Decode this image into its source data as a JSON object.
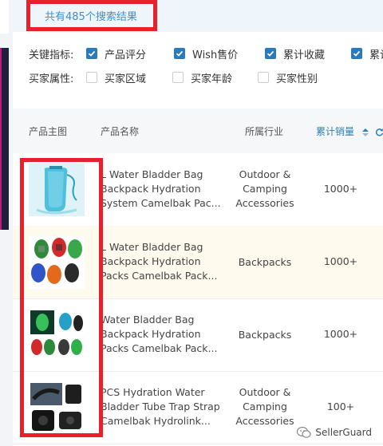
{
  "result_text": "共有485个搜索结果",
  "filters": {
    "key_label": "关键指标:",
    "key_options": [
      {
        "label": "产品评分",
        "checked": true
      },
      {
        "label": "Wish售价",
        "checked": true
      },
      {
        "label": "累计收藏",
        "checked": true
      },
      {
        "label": "累计",
        "checked": true
      }
    ],
    "buyer_label": "买家属性:",
    "buyer_options": [
      {
        "label": "买家区域",
        "checked": false
      },
      {
        "label": "买家年龄",
        "checked": false
      },
      {
        "label": "买家性别",
        "checked": false
      }
    ]
  },
  "table": {
    "headers": {
      "image": "产品主图",
      "name": "产品名称",
      "industry": "所属行业",
      "sales": "累计销量"
    },
    "rows": [
      {
        "name": "L Water Bladder Bag Backpack Hydration System Camelbak Pac...",
        "industry": "Outdoor & Camping Accessories",
        "sales": "1000+",
        "thumb": "blue-water-bladder"
      },
      {
        "name": "L Water Bladder Bag Backpack Hydration Packs Camelbak Pack...",
        "industry": "Backpacks",
        "sales": "1000+",
        "thumb": "colorful-hydration-backpacks"
      },
      {
        "name": "Water Bladder Bag Backpack Hydration Packs Camelbak Pack...",
        "industry": "Backpacks",
        "sales": "1000+",
        "thumb": "green-hydration-backpacks"
      },
      {
        "name": "PCS Hydration Water Bladder Tube Trap Strap Camelbak Hydrolink...",
        "industry": "Outdoor & Camping Accessories",
        "sales": "100+",
        "thumb": "black-tube-clips"
      }
    ]
  },
  "watermark": "SellerGuard",
  "colors": {
    "accent": "#2d7ab8",
    "highlight": "#e8202c",
    "row_highlight": "#fffaee"
  }
}
